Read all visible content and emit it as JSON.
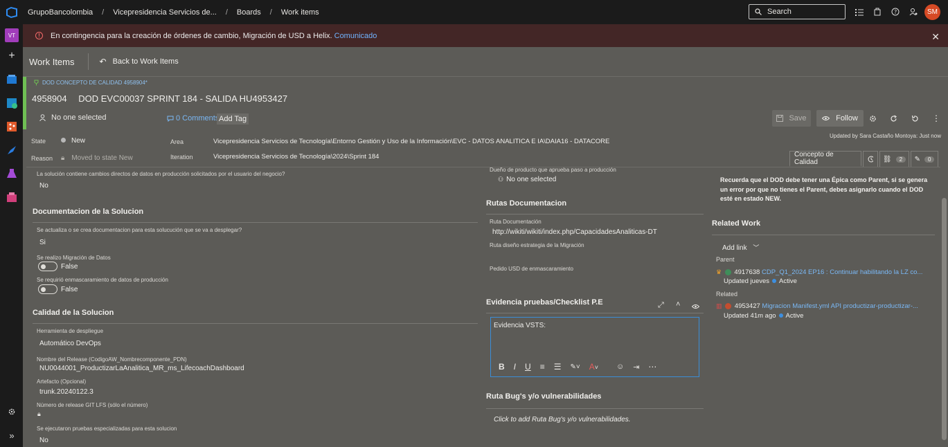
{
  "topbar": {
    "org": "GrupoBancolombia",
    "project": "Vicepresidencia Servicios de...",
    "boards": "Boards",
    "work_items": "Work items",
    "search_placeholder": "Search",
    "avatar_initials": "SM"
  },
  "rail": {
    "project_badge": "VT",
    "add": "+"
  },
  "banner": {
    "message": "En contingencia para la creación de órdenes de cambio, Migración de USD a Helix.",
    "link": "Comunicado"
  },
  "header": {
    "title": "Work Items",
    "back": "Back to Work Items"
  },
  "workitem": {
    "type_line": "DOD CONCEPTO DE CALIDAD 4958904*",
    "id": "4958904",
    "title": "DOD EVC00037 SPRINT 184 - SALIDA HU4953427",
    "assigned": "No one selected",
    "comments": "0 Comments",
    "add_tag": "Add Tag",
    "save": "Save",
    "follow": "Follow",
    "updated_by": "Updated by Sara Castaño Montoya: Just now",
    "state_label": "State",
    "state_value": "New",
    "reason_label": "Reason",
    "reason_value": "Moved to state New",
    "area_label": "Area",
    "area_value": "Vicepresidencia Servicios de Tecnología\\Entorno Gestión y Uso de la Información\\EVC - DATOS ANALITICA E IA\\DAIA16 - DATACORE",
    "iteration_label": "Iteration",
    "iteration_value": "Vicepresidencia Servicios de Tecnología\\2024\\Sprint 184"
  },
  "tabs": {
    "active": "Concepto de Calidad",
    "links_count": "2",
    "attachments_count": "0"
  },
  "left": {
    "q_cambios": "La solución contiene cambios directos de datos en producción solicitados por el usuario del negocio?",
    "a_cambios": "No",
    "sec_doc": "Documentacion de la Solucion",
    "q_doc": "Se actualiza o se crea documentacion para esta solucución que se va a desplegar?",
    "a_doc": "Si",
    "q_migracion": "Se realizo Migración de Datos",
    "a_migracion": "False",
    "q_enmasc": "Se requirió enmascaramiento de datos de producción",
    "a_enmasc": "False",
    "sec_calidad": "Calidad de la Solucion",
    "q_herramienta": "Herramienta de despliegue",
    "a_herramienta": "Automático DevOps",
    "q_release": "Nombre del Release (CodigoAW_Nombrecomponente_PDN)",
    "a_release": "NU0044001_ProductizarLaAnalitica_MR_ms_LifecoachDashboard",
    "q_artefacto": "Artefacto (Opcional)",
    "a_artefacto": "trunk.20240122.3",
    "q_gitlfs": "Número de release GIT LFS (sólo el número)",
    "q_pruebas": "Se ejecutaron pruebas especializadas para esta solucion",
    "a_pruebas": "No"
  },
  "middle": {
    "q_dueno": "Dueño de producto que aprueba paso a producción",
    "a_dueno": "No one selected",
    "sec_rutas": "Rutas Documentacion",
    "q_ruta": "Ruta Documentación",
    "a_ruta": "http://wikiti/wikiti/index.php/CapacidadesAnaliticas-DT",
    "q_ruta_mig": "Ruta diseño estrategia de la Migración",
    "q_pedido": "Pedido USD de enmascaramiento",
    "sec_evidencia": "Evidencia pruebas/Checklist P.E",
    "editor_text": "Evidencia VSTS:",
    "sec_bugs": "Ruta Bug's y/o vulnerabilidades",
    "bugs_placeholder": "Click to add Ruta Bug's y/o vulnerabilidades."
  },
  "right": {
    "notice": "Recuerda que el DOD debe tener una Épica como Parent, si se genera un error por que no tienes el Parent, debes asignarlo cuando el DOD esté en estado NEW.",
    "related_work": "Related Work",
    "add_link": "Add link",
    "parent_label": "Parent",
    "parent_id": "4917638",
    "parent_title": "CDP_Q1_2024 EP16 : Continuar habilitando la LZ co...",
    "parent_updated": "Updated jueves",
    "parent_state": "Active",
    "related_label": "Related",
    "related_id": "4953427",
    "related_title": "Migracion Manifest.yml API productizar-productizar-...",
    "related_updated": "Updated 41m ago",
    "related_state": "Active"
  },
  "colors": {
    "accent": "#3b8ed8",
    "banner_bg": "#432626",
    "type_green": "#6fbf54",
    "avatar": "#d64a25"
  }
}
